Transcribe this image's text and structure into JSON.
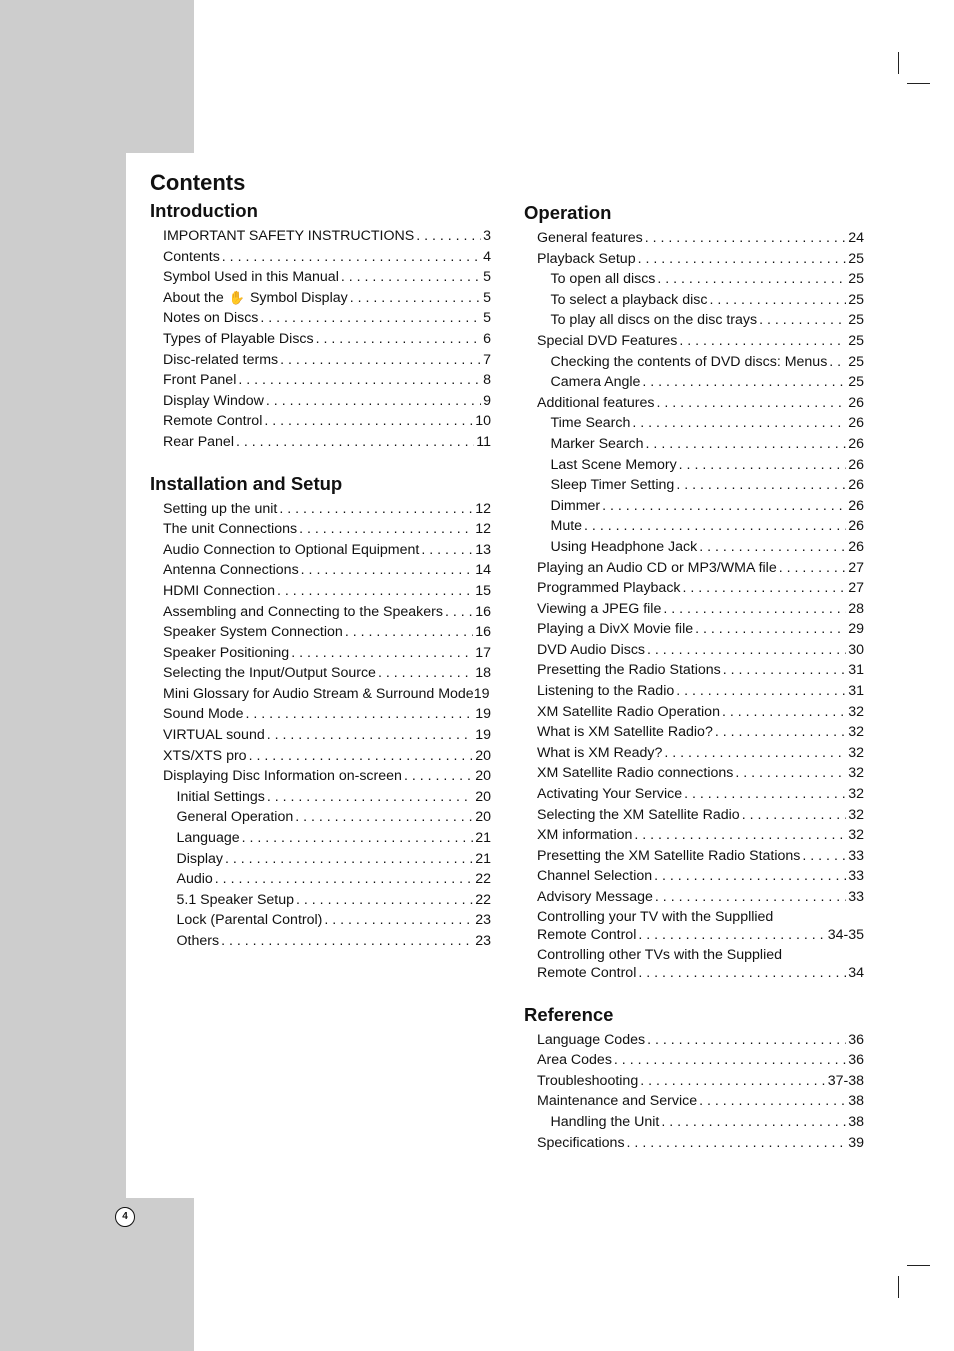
{
  "title": "Contents",
  "page_number": "4",
  "columns": [
    {
      "sections": [
        {
          "heading": "Introduction",
          "entries": [
            {
              "label": "IMPORTANT SAFETY INSTRUCTIONS",
              "page": "3",
              "level": 1
            },
            {
              "label": "Contents",
              "page": "4",
              "level": 1
            },
            {
              "label": "Symbol Used in this Manual",
              "page": "5",
              "level": 1
            },
            {
              "label": "About the",
              "icon": "hand-icon",
              "label_after": "Symbol Display",
              "page": "5",
              "level": 1
            },
            {
              "label": "Notes on Discs",
              "page": "5",
              "level": 1
            },
            {
              "label": "Types of Playable Discs",
              "page": "6",
              "level": 1
            },
            {
              "label": "Disc-related terms",
              "page": "7",
              "level": 1
            },
            {
              "label": "Front Panel",
              "page": "8",
              "level": 1
            },
            {
              "label": "Display Window",
              "page": "9",
              "level": 1
            },
            {
              "label": "Remote Control",
              "page": "10",
              "level": 1
            },
            {
              "label": "Rear Panel",
              "page": "11",
              "level": 1
            }
          ]
        },
        {
          "heading": "Installation and Setup",
          "entries": [
            {
              "label": "Setting up the unit",
              "page": "12",
              "level": 1
            },
            {
              "label": "The unit Connections",
              "page": "12",
              "level": 1
            },
            {
              "label": "Audio Connection to Optional Equipment",
              "page": "13",
              "level": 1
            },
            {
              "label": "Antenna Connections",
              "page": "14",
              "level": 1
            },
            {
              "label": "HDMI Connection",
              "page": "15",
              "level": 1
            },
            {
              "label": "Assembling and Connecting to the Speakers",
              "page": "16",
              "level": 1
            },
            {
              "label": "Speaker System Connection",
              "page": "16",
              "level": 1
            },
            {
              "label": "Speaker Positioning",
              "page": "17",
              "level": 1
            },
            {
              "label": "Selecting the Input/Output Source",
              "page": "18",
              "level": 1
            },
            {
              "label": "Mini Glossary for Audio Stream & Surround Mode",
              "page": "19",
              "level": 1,
              "no_leader": true
            },
            {
              "label": "Sound Mode",
              "page": "19",
              "level": 1
            },
            {
              "label": "VIRTUAL sound",
              "page": "19",
              "level": 1
            },
            {
              "label": "XTS/XTS pro",
              "page": "20",
              "level": 1
            },
            {
              "label": "Displaying Disc Information on-screen",
              "page": "20",
              "level": 1
            },
            {
              "label": "Initial Settings",
              "page": "20",
              "level": 2
            },
            {
              "label": "General Operation",
              "page": "20",
              "level": 2
            },
            {
              "label": "Language",
              "page": "21",
              "level": 2
            },
            {
              "label": "Display",
              "page": "21",
              "level": 2
            },
            {
              "label": "Audio",
              "page": "22",
              "level": 2
            },
            {
              "label": "5.1 Speaker Setup",
              "page": "22",
              "level": 2
            },
            {
              "label": "Lock (Parental Control)",
              "page": "23",
              "level": 2
            },
            {
              "label": "Others",
              "page": "23",
              "level": 2
            }
          ]
        }
      ]
    },
    {
      "sections": [
        {
          "heading": "Operation",
          "entries": [
            {
              "label": "General features",
              "page": "24",
              "level": 1
            },
            {
              "label": "Playback Setup",
              "page": "25",
              "level": 1
            },
            {
              "label": "To open all discs",
              "page": "25",
              "level": 2
            },
            {
              "label": "To select a playback disc",
              "page": "25",
              "level": 2
            },
            {
              "label": "To play all discs on the disc trays",
              "page": "25",
              "level": 2
            },
            {
              "label": "Special DVD Features",
              "page": "25",
              "level": 1
            },
            {
              "label": "Checking the contents of DVD discs: Menus",
              "page": "25",
              "level": 2
            },
            {
              "label": "Camera Angle",
              "page": "25",
              "level": 2
            },
            {
              "label": "Additional features",
              "page": "26",
              "level": 1
            },
            {
              "label": "Time Search",
              "page": "26",
              "level": 2
            },
            {
              "label": "Marker Search",
              "page": "26",
              "level": 2
            },
            {
              "label": "Last Scene Memory",
              "page": "26",
              "level": 2
            },
            {
              "label": "Sleep Timer Setting",
              "page": "26",
              "level": 2
            },
            {
              "label": "Dimmer",
              "page": "26",
              "level": 2
            },
            {
              "label": "Mute",
              "page": "26",
              "level": 2
            },
            {
              "label": "Using Headphone Jack",
              "page": "26",
              "level": 2
            },
            {
              "label": "Playing an Audio CD or MP3/WMA file",
              "page": "27",
              "level": 1
            },
            {
              "label": "Programmed Playback",
              "page": "27",
              "level": 1
            },
            {
              "label": "Viewing a JPEG file",
              "page": "28",
              "level": 1
            },
            {
              "label": "Playing a DivX Movie file",
              "page": "29",
              "level": 1
            },
            {
              "label": "DVD Audio Discs",
              "page": "30",
              "level": 1
            },
            {
              "label": "Presetting the Radio Stations",
              "page": "31",
              "level": 1
            },
            {
              "label": "Listening to the Radio",
              "page": "31",
              "level": 1
            },
            {
              "label": "XM Satellite Radio Operation",
              "page": "32",
              "level": 1
            },
            {
              "label": "What is XM Satellite Radio?",
              "page": "32",
              "level": 1
            },
            {
              "label": "What is XM Ready?",
              "page": "32",
              "level": 1
            },
            {
              "label": "XM Satellite Radio connections",
              "page": "32",
              "level": 1
            },
            {
              "label": "Activating Your Service",
              "page": "32",
              "level": 1
            },
            {
              "label": "Selecting the XM Satellite Radio",
              "page": "32",
              "level": 1
            },
            {
              "label": "XM information",
              "page": "32",
              "level": 1
            },
            {
              "label": "Presetting the XM Satellite Radio Stations",
              "page": "33",
              "level": 1
            },
            {
              "label": "Channel Selection",
              "page": "33",
              "level": 1
            },
            {
              "label": "Advisory Message",
              "page": "33",
              "level": 1
            },
            {
              "label_line1": "Controlling your TV with the Suppllied",
              "label": "Remote Control",
              "page": "34-35",
              "level": 1
            },
            {
              "label_line1": "Controlling other TVs with the Supplied",
              "label": "Remote Control",
              "page": "34",
              "level": 1
            }
          ]
        },
        {
          "heading": "Reference",
          "entries": [
            {
              "label": "Language Codes",
              "page": "36",
              "level": 1
            },
            {
              "label": "Area Codes",
              "page": "36",
              "level": 1
            },
            {
              "label": "Troubleshooting",
              "page": "37-38",
              "level": 1
            },
            {
              "label": "Maintenance and Service",
              "page": "38",
              "level": 1
            },
            {
              "label": "Handling the Unit",
              "page": "38",
              "level": 2
            },
            {
              "label": "Specifications",
              "page": "39",
              "level": 1
            }
          ]
        }
      ]
    }
  ]
}
